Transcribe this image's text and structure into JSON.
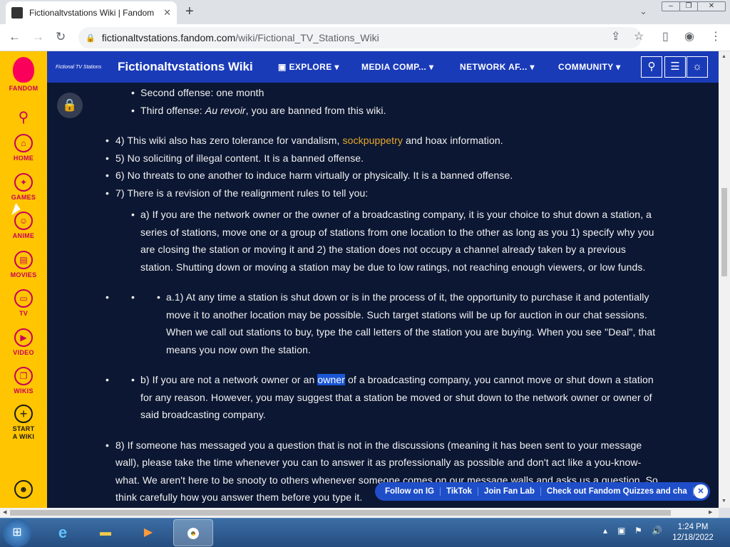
{
  "browser": {
    "tab_title": "Fictionaltvstations Wiki | Fandom",
    "tab_close": "✕",
    "new_tab": "+",
    "url_host": "fictionaltvstations.fandom.com",
    "url_path": "/wiki/Fictional_TV_Stations_Wiki"
  },
  "fandom_rail": {
    "brand": "FANDOM",
    "items": [
      {
        "label": "HOME",
        "icon": "home-icon"
      },
      {
        "label": "GAMES",
        "icon": "gamepad-icon"
      },
      {
        "label": "ANIME",
        "icon": "anime-icon"
      },
      {
        "label": "MOVIES",
        "icon": "film-icon"
      },
      {
        "label": "TV",
        "icon": "tv-icon"
      },
      {
        "label": "VIDEO",
        "icon": "play-icon"
      },
      {
        "label": "WIKIS",
        "icon": "book-icon"
      },
      {
        "label": "START A WIKI",
        "icon": "plus-icon"
      }
    ]
  },
  "wiki_header": {
    "logo_text": "Fictional TV Stations",
    "wiki_name": "Fictionaltvstations Wiki",
    "nav": [
      "EXPLORE",
      "MEDIA COMP...",
      "NETWORK AF...",
      "COMMUNITY"
    ]
  },
  "content": {
    "line_second_offense": "Second offense: one month",
    "line_third_offense_a": "Third offense: ",
    "line_third_offense_b": "Au revoir",
    "line_third_offense_c": ", you are banned from this wiki.",
    "rule4_a": "4) This wiki also has zero tolerance for vandalism, ",
    "rule4_link": "sockpuppetry",
    "rule4_b": " and hoax information.",
    "rule5": "5) No soliciting of illegal content. It is a banned offense.",
    "rule6": "6) No threats to one another to induce harm virtually or physically. It is a banned offense.",
    "rule7": "7) There is a revision of the realignment rules to tell you:",
    "rule7a": [
      "a) If you are the network owner or the owner of a broadcasting company, it is your choice to shut down a station, a",
      "series of stations, move one or a group of stations from one location to the other as long as you 1) specify why you",
      "are closing the station or moving it and 2) the station does not occupy a channel already taken by a previous",
      "station. Shutting down or moving a station may be due to low ratings, not reaching enough viewers, or low funds."
    ],
    "rule7a1": [
      "a.1) At any time a station is shut down or is in the process of it, the opportunity to purchase it and potentially",
      "move it to another location may be possible. Such target stations will be up for auction in our chat sessions.",
      "When we call out stations to buy, type the call letters of the station you are buying. When you see \"Deal\", that",
      "means you now own the station."
    ],
    "rule7b_a": "b) If you are not a network owner or an ",
    "rule7b_hl": "owner",
    "rule7b_b": " of a broadcasting company, you cannot move or shut down a station",
    "rule7b_lines": [
      "for any reason. However, you may suggest that a station be moved or shut down to the network owner or owner of",
      "said broadcasting company."
    ],
    "rule8": [
      "8) If someone has messaged you a question that is not in the discussions (meaning it has been sent to your message",
      "wall), please take the time whenever you can to answer it as professionally as possible and don't act like a you-know-",
      "what. We aren't here to be snooty to others whenever someone comes on our message walls and asks us a question. So",
      "think carefully how you answer them before you type it."
    ]
  },
  "follow_bar": [
    "Follow on IG",
    "TikTok",
    "Join Fan Lab",
    "Check out Fandom Quizzes and cha"
  ],
  "taskbar": {
    "time": "1:24 PM",
    "date": "12/18/2022"
  }
}
